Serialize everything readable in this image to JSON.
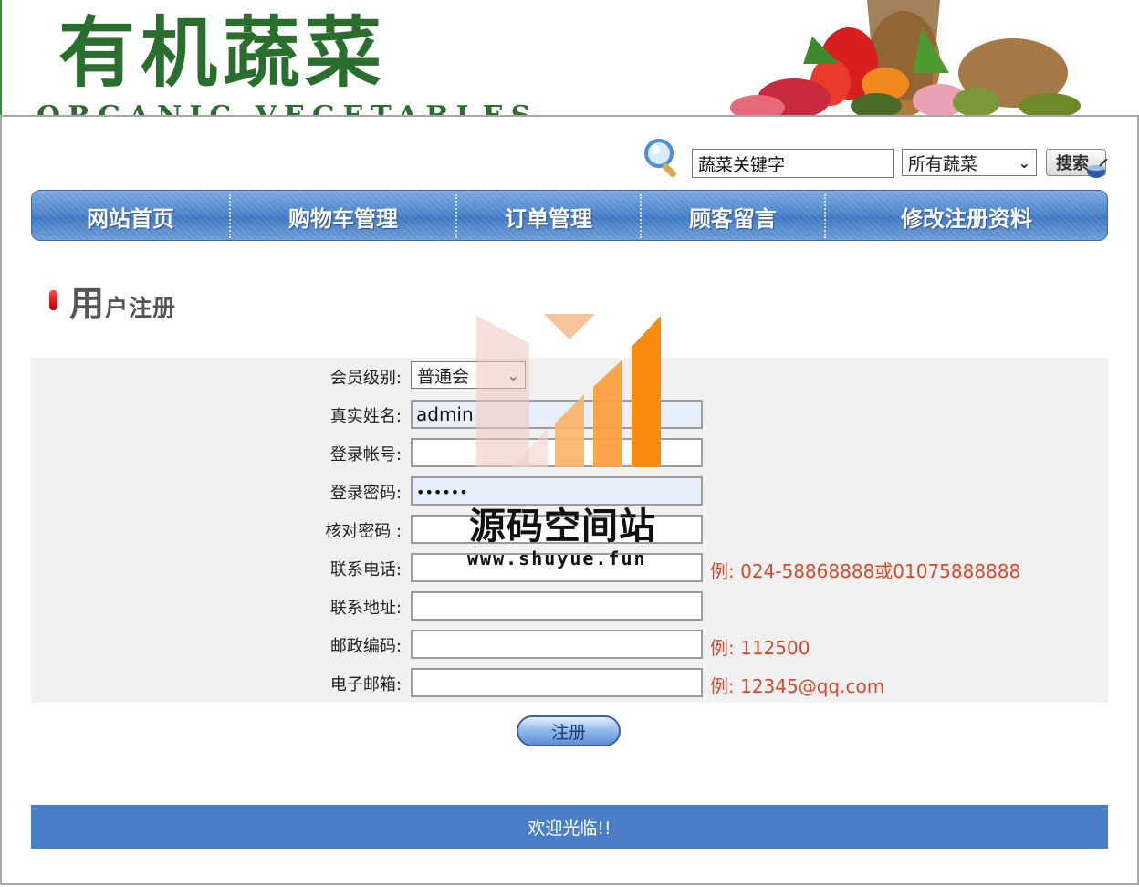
{
  "header": {
    "logo_cn": "有机蔬菜",
    "logo_en": "ORGANIC VEGETABLES"
  },
  "search": {
    "keyword_value": "蔬菜关键字",
    "category_selected": "所有蔬菜",
    "button_label": "搜索"
  },
  "nav": {
    "items": [
      {
        "label": "网站首页"
      },
      {
        "label": "购物车管理"
      },
      {
        "label": "订单管理"
      },
      {
        "label": "顾客留言"
      },
      {
        "label": "修改注册资料"
      }
    ]
  },
  "section": {
    "title_big": "用",
    "title_small": "户注册"
  },
  "form": {
    "member_level": {
      "label": "会员级别:",
      "selected": "普通会"
    },
    "real_name": {
      "label": "真实姓名:",
      "value": "admin"
    },
    "login_account": {
      "label": "登录帐号:",
      "value": ""
    },
    "login_password": {
      "label": "登录密码:",
      "value": "••••••"
    },
    "confirm_password": {
      "label": "核对密码 :",
      "value": ""
    },
    "phone": {
      "label": "联系电话:",
      "value": "",
      "hint": "例: 024-58868888或01075888888"
    },
    "address": {
      "label": "联系地址:",
      "value": ""
    },
    "postcode": {
      "label": "邮政编码:",
      "value": "",
      "hint": "例: 112500"
    },
    "email": {
      "label": "电子邮箱:",
      "value": "",
      "hint": "例: 12345@qq.com"
    },
    "submit_label": "注册"
  },
  "footer": {
    "text": "欢迎光临!!"
  },
  "watermark": {
    "name": "源码空间站",
    "url": "www.shuyue.fun"
  },
  "colors": {
    "brand_green": "#2a6e2d",
    "nav_blue": "#4d85cc",
    "footer_blue": "#4a7fc7",
    "hint_red": "#d64a2b"
  }
}
